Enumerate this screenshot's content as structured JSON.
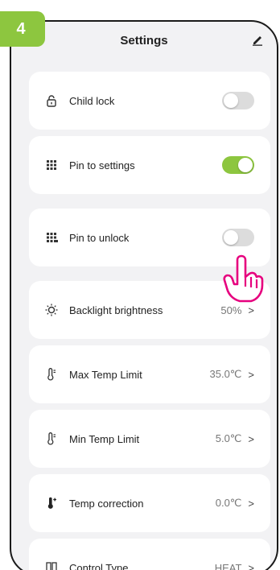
{
  "step": "4",
  "header": {
    "title": "Settings"
  },
  "colors": {
    "accent": "#8dc63f",
    "toggle_off": "#dcdcdc",
    "pointer": "#e6007e"
  },
  "items": [
    {
      "label": "Child lock",
      "icon": "lock-icon",
      "toggle": false
    },
    {
      "label": "Pin to settings",
      "icon": "grid-dots-icon",
      "toggle": true
    },
    {
      "label": "Pin to unlock",
      "icon": "grid-dots-icon",
      "toggle": false
    },
    {
      "label": "Backlight brightness",
      "icon": "brightness-icon",
      "value": "50%",
      "chevron": ">"
    },
    {
      "label": "Max Temp Limit",
      "icon": "thermometer-icon",
      "value": "35.0℃",
      "chevron": ">"
    },
    {
      "label": "Min Temp Limit",
      "icon": "thermometer-icon",
      "value": "5.0℃",
      "chevron": ">"
    },
    {
      "label": "Temp correction",
      "icon": "thermometer-plus-icon",
      "value": "0.0℃",
      "chevron": ">"
    },
    {
      "label": "Control Type",
      "icon": "control-type-icon",
      "value": "HEAT",
      "chevron": ">"
    }
  ]
}
